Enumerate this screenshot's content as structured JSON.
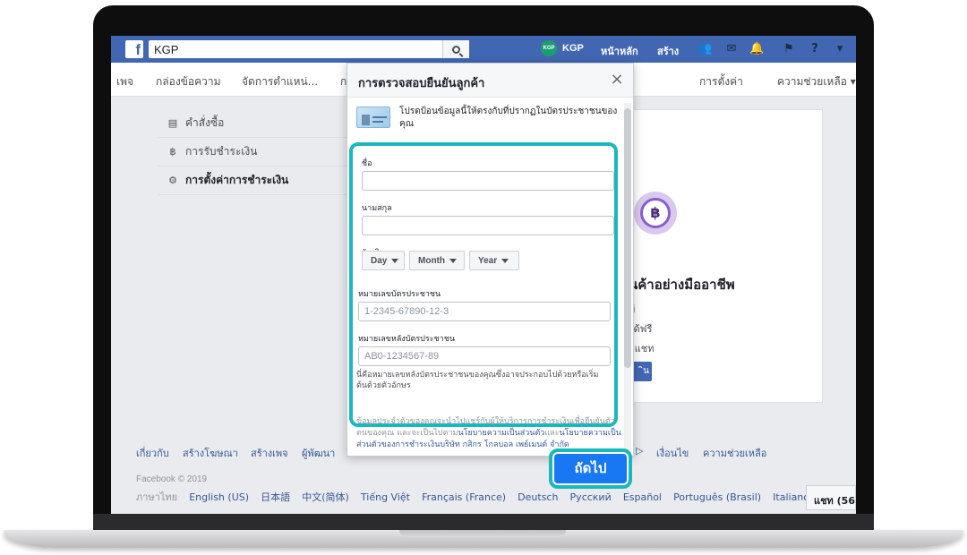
{
  "topbar": {
    "search_value": "KGP",
    "profile_avatar": "KGP",
    "profile_name": "KGP",
    "nav_home": "หน้าหลัก",
    "nav_create": "สร้าง"
  },
  "pagenav": {
    "items": [
      "เพจ",
      "กล่องข้อความ",
      "จัดการตำแหน่...",
      "ก",
      "การตั้งค่า",
      "ความช่วยเหลือ ▾"
    ]
  },
  "left_menu": {
    "items": [
      {
        "label": "คำสั่งซื้อ",
        "icon": "receipt-icon"
      },
      {
        "label": "การรับชำระเงิน",
        "icon": "baht-icon"
      },
      {
        "label": "การตั้งค่าการชำระเงิน",
        "icon": "gear-icon"
      }
    ]
  },
  "promo": {
    "baht_symbol": "฿",
    "title": "ินค้าอย่างมืออาชีพ",
    "lines": [
      "ที",
      "ได้ฟรี",
      "กแชท"
    ],
    "button": "ิน"
  },
  "modal": {
    "title": "การตรวจสอบยืนยันลูกค้า",
    "close_glyph": "×",
    "intro": "โปรดป้อนข้อมูลนี้ให้ตรงกับที่ปรากฏในบัตรประชาชนของคุณ",
    "first_name_label": "ชื่อ",
    "last_name_label": "นามสกุล",
    "birthday_label": "วันเกิด",
    "day": "Day",
    "month": "Month",
    "year": "Year",
    "id_label": "หมายเลขบัตรประชาชน",
    "id_placeholder": "1-2345-67890-12-3",
    "back_label": "หมายเลขหลังบัตรประชาชน",
    "back_placeholder": "AB0-1234567-89",
    "back_hint": "นี่คือหมายเลขหลังบัตรประชาชนของคุณซึ่งอาจประกอบไปด้วยหรือเริ่มต้นด้วยตัวอักษร",
    "privacy_before": "ข้อมูลประจำตัวของคุณจะนำไปแชร์กับผู้ให้บริการการชำระเงินเพื่อยืนยันตัวตนของคุณ และจะเป็นไปตาม",
    "privacy_link1": "นโยบายความเป็นส่วนตัว",
    "privacy_mid": "และ",
    "privacy_link2": "นโยบายความเป็นส่วนตัวของการชำระเงินบริษัท กสิกร โกลบอล เพย์เมนต์ จำกัด",
    "next_button": "ถัดไป"
  },
  "footer": {
    "links": [
      "เกี่ยวกับ",
      "สร้างโฆษณา",
      "สร้างเพจ",
      "ผู้พัฒนา",
      "▷",
      "เงื่อนไข",
      "ความช่วยเหลือ"
    ],
    "copyright": "Facebook © 2019",
    "languages": [
      "ภาษาไทย",
      "English (US)",
      "日本語",
      "中文(简体)",
      "Tiếng Việt",
      "Français (France)",
      "Deutsch",
      "Русский",
      "Español",
      "Português (Brasil)",
      "Italiano"
    ],
    "lang_plus": "+",
    "chat": "แชท (56"
  }
}
